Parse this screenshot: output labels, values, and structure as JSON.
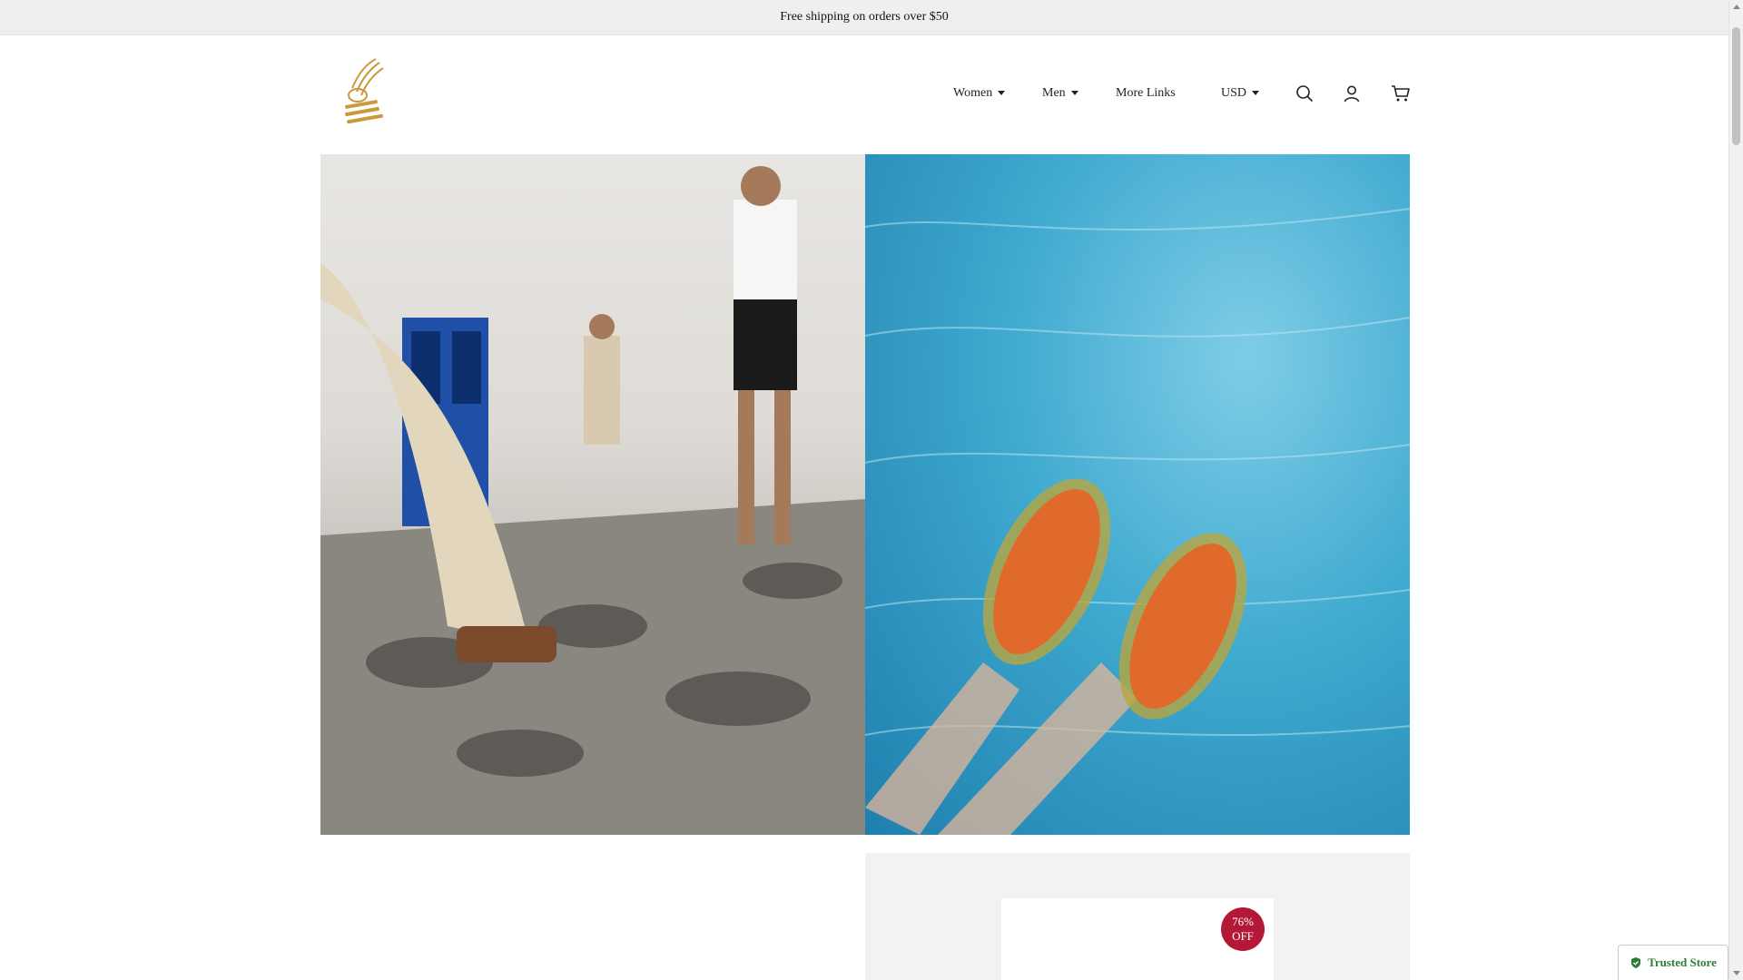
{
  "announcement": {
    "text": "Free shipping on orders over $50"
  },
  "header": {
    "logo_alt": "Ancient Greek Sandals",
    "nav": [
      {
        "label": "Women",
        "has_dropdown": true
      },
      {
        "label": "Men",
        "has_dropdown": true
      },
      {
        "label": "More Links",
        "has_dropdown": false
      }
    ],
    "currency": {
      "value": "USD"
    },
    "icons": [
      "search-icon",
      "account-icon",
      "cart-icon"
    ]
  },
  "hero": {
    "left_image": "people-walking-in-sandals-photo",
    "right_image": "jelly-sandals-in-pool-photo"
  },
  "product_card": {
    "badge_line1": "76%",
    "badge_line2": "OFF"
  },
  "trust_badge": {
    "label": "Trusted Store"
  },
  "colors": {
    "accent_badge": "#b31837",
    "trusted_green": "#2e7d32",
    "logo_gold": "#c99a3b"
  }
}
